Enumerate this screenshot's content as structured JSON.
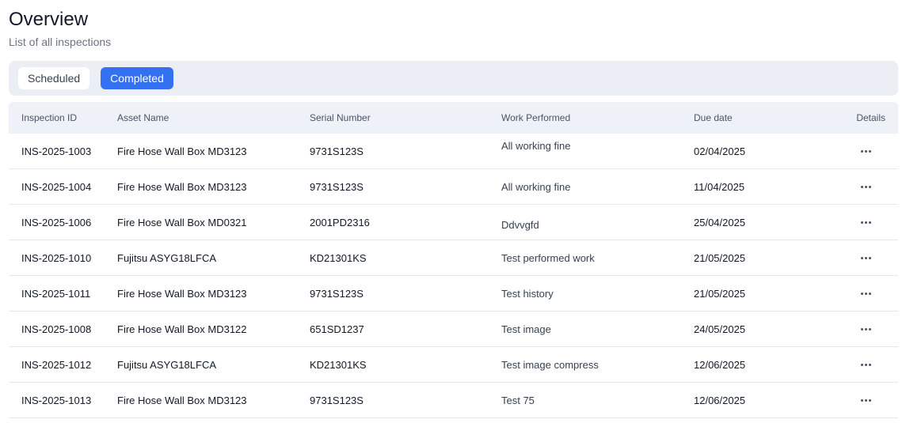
{
  "header": {
    "title": "Overview",
    "subtitle": "List of all inspections"
  },
  "tabs": [
    {
      "label": "Scheduled",
      "active": false
    },
    {
      "label": "Completed",
      "active": true
    }
  ],
  "table": {
    "columns": [
      "Inspection ID",
      "Asset Name",
      "Serial Number",
      "Work Performed",
      "Due date",
      "Details"
    ],
    "rows": [
      {
        "id": "INS-2025-1003",
        "asset": "Fire Hose Wall Box MD3123",
        "serial": "9731S123S",
        "work": "All working fine",
        "due": "02/04/2025"
      },
      {
        "id": "INS-2025-1004",
        "asset": "Fire Hose Wall Box MD3123",
        "serial": "9731S123S",
        "work": "All working fine",
        "due": "11/04/2025"
      },
      {
        "id": "INS-2025-1006",
        "asset": "Fire Hose Wall Box MD0321",
        "serial": "2001PD2316",
        "work": "Ddvvgfd",
        "due": "25/04/2025"
      },
      {
        "id": "INS-2025-1010",
        "asset": "Fujitsu ASYG18LFCA",
        "serial": "KD21301KS",
        "work": "Test performed work",
        "due": "21/05/2025"
      },
      {
        "id": "INS-2025-1011",
        "asset": "Fire Hose Wall Box MD3123",
        "serial": "9731S123S",
        "work": "Test history",
        "due": "21/05/2025"
      },
      {
        "id": "INS-2025-1008",
        "asset": "Fire Hose Wall Box MD3122",
        "serial": "651SD1237",
        "work": "Test image",
        "due": "24/05/2025"
      },
      {
        "id": "INS-2025-1012",
        "asset": "Fujitsu ASYG18LFCA",
        "serial": "KD21301KS",
        "work": "Test image compress",
        "due": "12/06/2025"
      },
      {
        "id": "INS-2025-1013",
        "asset": "Fire Hose Wall Box MD3123",
        "serial": "9731S123S",
        "work": "Test 75",
        "due": "12/06/2025"
      }
    ],
    "details_icon": "more-horizontal-icon"
  },
  "colors": {
    "accent": "#3370f2",
    "tabs_bg": "#eceef6",
    "header_bg": "#eef1f7"
  }
}
